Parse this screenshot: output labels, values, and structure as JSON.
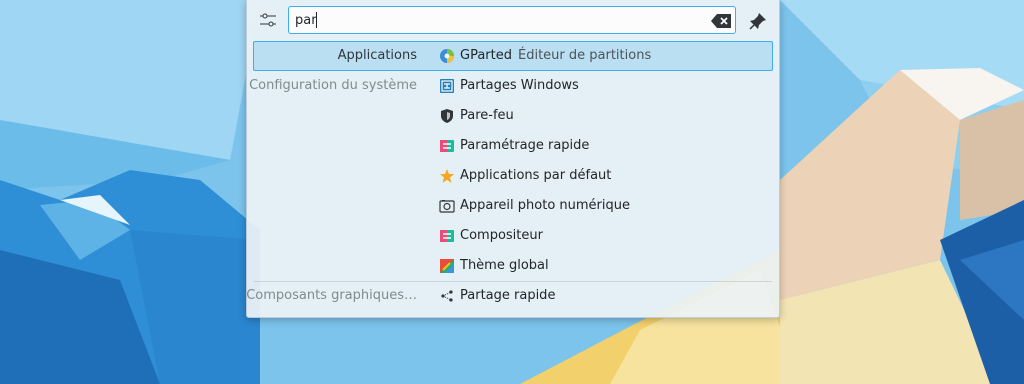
{
  "search": {
    "value": "par"
  },
  "results": [
    {
      "category": "Applications",
      "label": "GParted",
      "subtext": "Éditeur de partitions",
      "icon": "gparted-icon",
      "selected": true
    },
    {
      "category": "Configuration du système",
      "label": "Partages Windows",
      "icon": "windows-shares-icon"
    },
    {
      "category": "",
      "label": "Pare-feu",
      "icon": "firewall-shield-icon"
    },
    {
      "category": "",
      "label": "Paramétrage rapide",
      "icon": "quick-settings-icon"
    },
    {
      "category": "",
      "label": "Applications par défaut",
      "icon": "star-icon"
    },
    {
      "category": "",
      "label": "Appareil photo numérique",
      "icon": "camera-icon"
    },
    {
      "category": "",
      "label": "Compositeur",
      "icon": "compositor-icon"
    },
    {
      "category": "",
      "label": "Thème global",
      "icon": "global-theme-icon"
    },
    {
      "category": "Composants graphiques…",
      "label": "Partage rapide",
      "icon": "share-icon"
    }
  ],
  "colors": {
    "accent": "#3daee9",
    "panel": "#eef3f6"
  }
}
